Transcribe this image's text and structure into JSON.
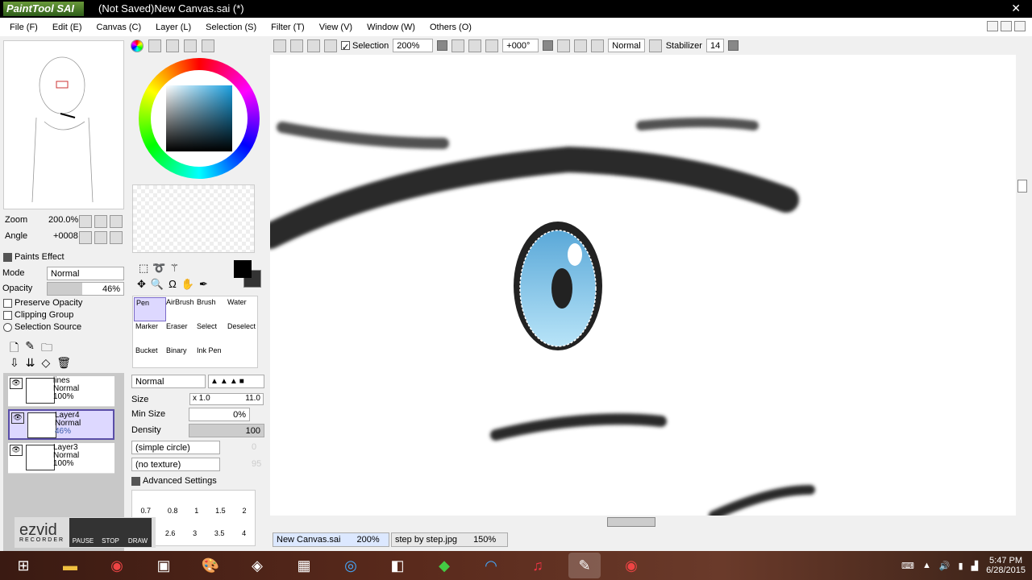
{
  "titlebar": {
    "app": "PaintTool SAI",
    "title": "(Not Saved)New Canvas.sai (*)",
    "close": "✕"
  },
  "menu": [
    "File (F)",
    "Edit (E)",
    "Canvas (C)",
    "Layer (L)",
    "Selection (S)",
    "Filter (T)",
    "View (V)",
    "Window (W)",
    "Others (O)"
  ],
  "toolbar": {
    "selection_label": "Selection",
    "zoom": "200%",
    "angle": "+000°",
    "mode": "Normal",
    "stabilizer_label": "Stabilizer",
    "stabilizer": "14"
  },
  "navigator": {
    "zoom_label": "Zoom",
    "zoom": "200.0%",
    "angle_label": "Angle",
    "angle": "+0008"
  },
  "layer_panel": {
    "paints_effect": "Paints Effect",
    "mode_label": "Mode",
    "mode": "Normal",
    "opacity_label": "Opacity",
    "opacity": "46%",
    "opacity_value": 46,
    "preserve_opacity": "Preserve Opacity",
    "clipping_group": "Clipping Group",
    "selection_source": "Selection Source",
    "layers": [
      {
        "name": "lines",
        "mode": "Normal",
        "opacity": "100%"
      },
      {
        "name": "Layer4",
        "mode": "Normal",
        "opacity": "46%"
      },
      {
        "name": "Layer3",
        "mode": "Normal",
        "opacity": "100%"
      }
    ]
  },
  "tools": [
    "Pen",
    "AirBrush",
    "Brush",
    "Water",
    "Marker",
    "Eraser",
    "Select",
    "Deselect",
    "Bucket",
    "Binary",
    "Ink Pen"
  ],
  "brush": {
    "blend": "Normal",
    "size_label": "Size",
    "size_mult": "x 1.0",
    "size": "11.0",
    "min_size_label": "Min Size",
    "min_size": "0%",
    "density_label": "Density",
    "density": "100",
    "shape": "(simple circle)",
    "shape_val": "0",
    "texture": "(no texture)",
    "texture_val": "95",
    "advanced": "Advanced Settings",
    "sizes_row1": [
      "0.7",
      "0.8",
      "1",
      "1.5",
      "2"
    ],
    "sizes_row2": [
      "2.6",
      "3",
      "3.5",
      "4"
    ]
  },
  "recorder": {
    "brand": "ezvid",
    "sub": "RECORDER",
    "pause": "PAUSE",
    "stop": "STOP",
    "draw": "DRAW"
  },
  "status_tabs": [
    {
      "name": "New Canvas.sai",
      "zoom": "200%"
    },
    {
      "name": "step by step.jpg",
      "zoom": "150%"
    }
  ],
  "clock": {
    "time": "5:47 PM",
    "date": "6/28/2015"
  }
}
